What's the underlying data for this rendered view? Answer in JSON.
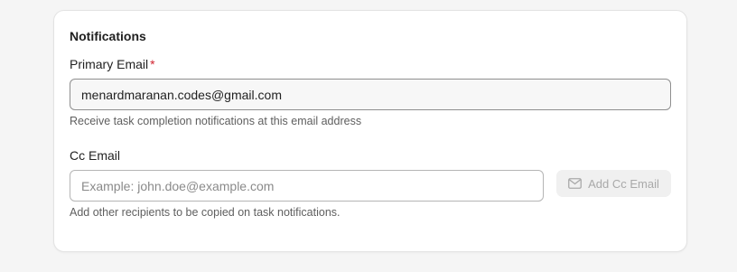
{
  "section": {
    "title": "Notifications"
  },
  "primary_email": {
    "label": "Primary Email",
    "required_mark": "*",
    "value": "menardmaranan.codes@gmail.com",
    "helper": "Receive task completion notifications at this email address"
  },
  "cc_email": {
    "label": "Cc Email",
    "placeholder": "Example: john.doe@example.com",
    "value": "",
    "helper": "Add other recipients to be copied on task notifications.",
    "add_button_label": "Add Cc Email",
    "add_button_icon": "mail-icon",
    "add_button_disabled": true
  }
}
